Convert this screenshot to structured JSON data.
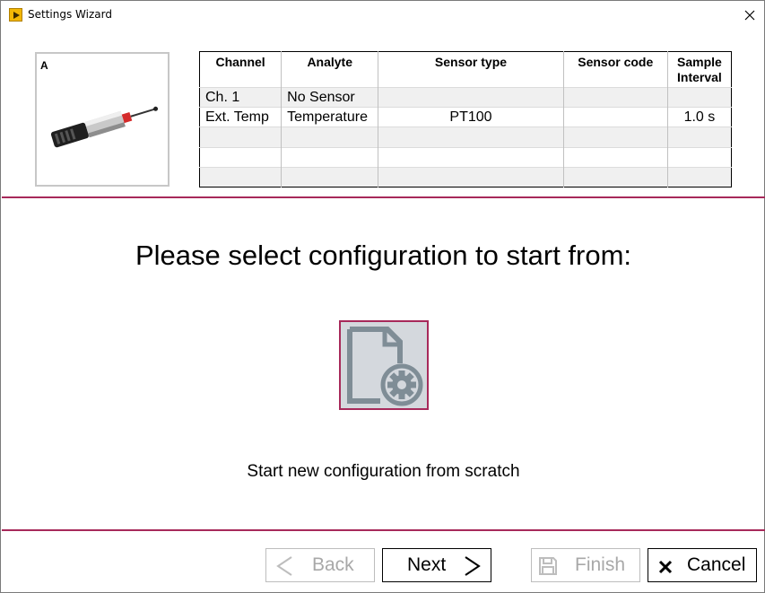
{
  "window": {
    "title": "Settings Wizard"
  },
  "icons": {
    "app": "labview-app-icon",
    "close": "close-icon",
    "config": "document-gear-icon",
    "back": "chevron-left-icon",
    "next": "chevron-right-icon",
    "finish": "save-disk-icon",
    "cancel": "x-icon"
  },
  "sensor_panel": {
    "label": "A"
  },
  "table": {
    "headers": [
      "Channel",
      "Analyte",
      "Sensor type",
      "Sensor code",
      "Sample Interval"
    ],
    "rows": [
      [
        "Ch. 1",
        "No Sensor",
        "",
        "",
        ""
      ],
      [
        "Ext. Temp",
        "Temperature",
        "PT100",
        "",
        "1.0 s"
      ],
      [
        "",
        "",
        "",
        "",
        ""
      ],
      [
        "",
        "",
        "",
        "",
        ""
      ],
      [
        "",
        "",
        "",
        "",
        ""
      ]
    ]
  },
  "main": {
    "prompt": "Please select configuration to start from:",
    "option_caption": "Start new configuration from scratch"
  },
  "buttons": {
    "back": "Back",
    "next": "Next",
    "finish": "Finish",
    "cancel": "Cancel"
  },
  "colors": {
    "accent": "#a7295a",
    "tile_bg": "#d4d8dd",
    "icon_gray": "#7f8d96"
  }
}
